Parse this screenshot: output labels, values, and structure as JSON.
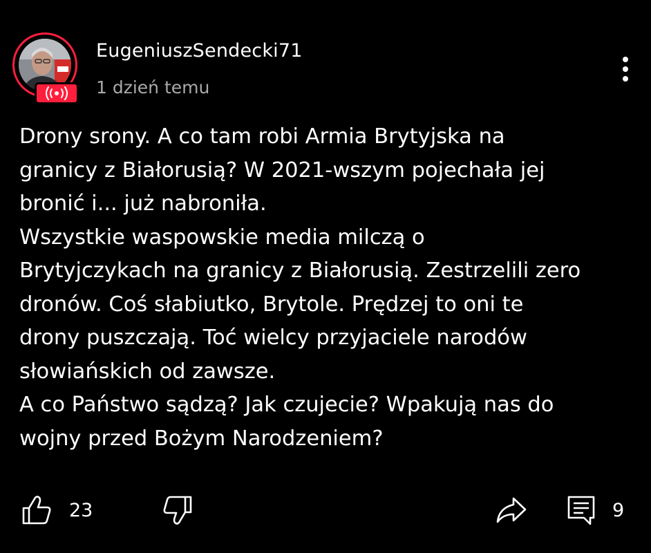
{
  "comment": {
    "author": "EugeniuszSendecki71",
    "timestamp": "1 dzień temu",
    "body": "Drony srony. A co tam robi Armia Brytyjska na\ngranicy z Białorusią? W 2021-wszym pojechała jej\nbronić i... już nabroniła.\nWszystkie waspowskie media milczą o\nBrytyjczykach na granicy z Białorusią. Zestrzelili zero\ndronów. Coś słabiutko, Brytole. Prędzej to oni te\ndrony puszczają. Toć wielcy przyjaciele narodów\nsłowiańskich od zawsze.\nA co Państwo sądzą? Jak czujecie? Wpakują nas do\nwojny przed Bożym Narodzeniem?",
    "avatar": {
      "icon": "user-avatar-photo",
      "live_badge_icon": "live-broadcast-icon",
      "ring_color": "#ff1f3d"
    },
    "actions": {
      "like_icon": "thumbs-up-icon",
      "like_count": "23",
      "dislike_icon": "thumbs-down-icon",
      "share_icon": "share-icon",
      "reply_icon": "reply-comment-icon",
      "reply_count": "9",
      "menu_icon": "more-vertical-icon"
    }
  }
}
